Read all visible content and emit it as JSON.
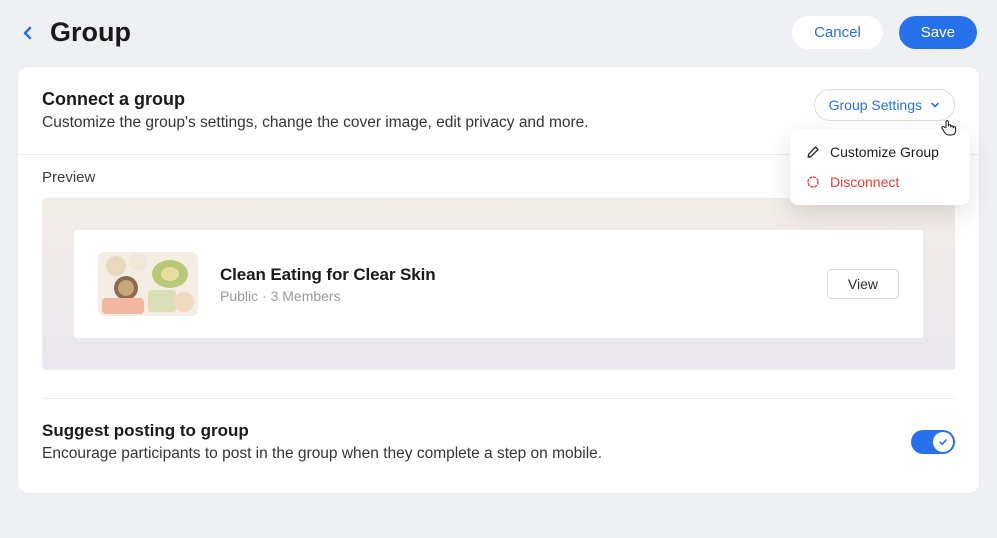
{
  "header": {
    "title": "Group",
    "cancel": "Cancel",
    "save": "Save"
  },
  "connect": {
    "title": "Connect a group",
    "description": "Customize the group's settings, change the cover image, edit privacy and more.",
    "settings_button": "Group Settings",
    "menu": {
      "customize": "Customize Group",
      "disconnect": "Disconnect"
    }
  },
  "preview": {
    "label": "Preview",
    "group_name": "Clean Eating for Clear Skin",
    "meta": "Public · 3 Members",
    "view": "View"
  },
  "suggest": {
    "title": "Suggest posting to group",
    "description": "Encourage participants to post in the group when they complete a step on mobile.",
    "enabled": true
  }
}
